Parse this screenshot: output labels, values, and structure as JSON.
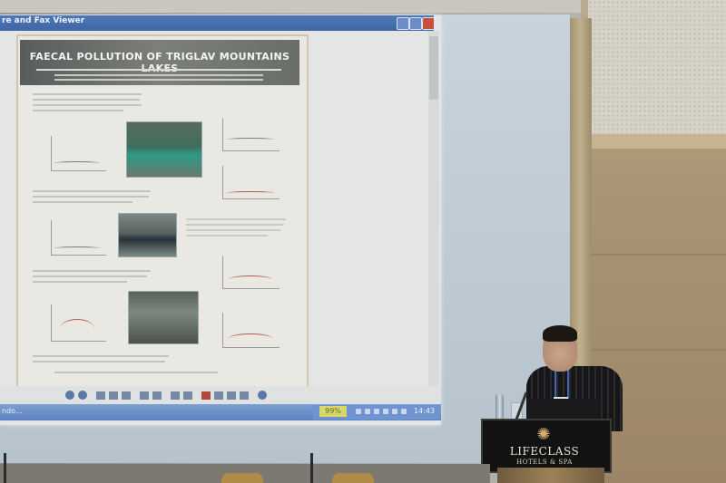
{
  "viewer": {
    "title": "re and Fax Viewer",
    "window_buttons": [
      "minimize",
      "maximize",
      "close"
    ]
  },
  "poster": {
    "title": "FAECAL POLLUTION OF TRIGLAV MOUNTAINS LAKES"
  },
  "taskbar": {
    "start_text": "ndo...",
    "zoom": "99%",
    "clock": "14:43"
  },
  "lectern": {
    "logo_main": "LIFECLASS",
    "logo_sub": "HOTELS & SPA"
  },
  "colors": {
    "titlebar": "#4e78b8",
    "taskbar": "#5c81c1",
    "screen": "#c8d3dc",
    "lectern": "#121212",
    "logo": "#d4b06a"
  }
}
